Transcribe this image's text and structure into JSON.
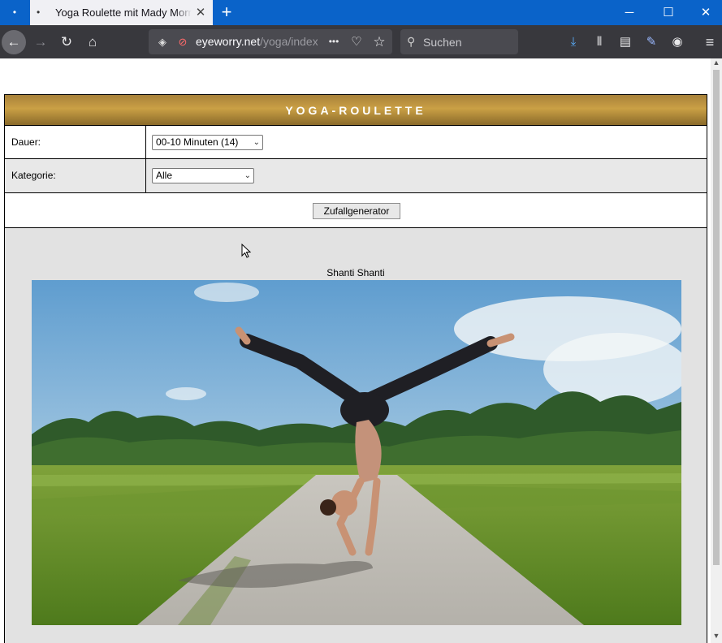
{
  "browser": {
    "tab_title": "Yoga Roulette mit Mady Morrison",
    "url_host": "eyeworry.net",
    "url_path": "/yoga/index",
    "search_placeholder": "Suchen",
    "accent_color": "#0a63c9"
  },
  "page": {
    "header": "YOGA-ROULETTE",
    "duration_label": "Dauer:",
    "duration_value": "00-10 Minuten (14)",
    "category_label": "Kategorie:",
    "category_value": "Alle",
    "button_label": "Zufallgenerator",
    "result_title": "Shanti Shanti",
    "header_color": "#b88f3e"
  },
  "icons": {
    "tab_dot": "•",
    "tab_close": "✕",
    "new_tab": "+",
    "minimize": "─",
    "maximize": "☐",
    "close_window": "✕",
    "back": "←",
    "forward": "→",
    "reload": "↻",
    "home": "⌂",
    "shield": "◈",
    "lock": "⊘",
    "more": "•••",
    "pocket": "♡",
    "bookmark": "☆",
    "search": "⚲",
    "download": "⤓",
    "library": "⫴",
    "sidebar": "▤",
    "pen": "✎",
    "account": "◉",
    "menu": "≡",
    "chevron": "⌄"
  }
}
